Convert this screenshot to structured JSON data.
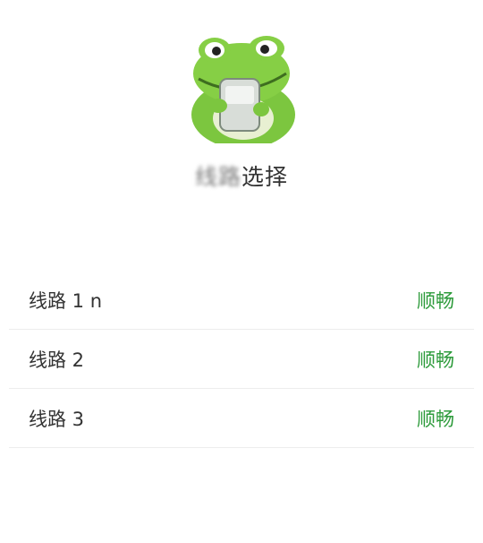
{
  "header": {
    "logo_icon": "frog-reading-phone-icon",
    "title_blurred": "线路",
    "title_visible": "选择"
  },
  "lines": [
    {
      "name": "线路 1 n",
      "status": "顺畅"
    },
    {
      "name": "线路 2",
      "status": "顺畅"
    },
    {
      "name": "线路 3",
      "status": "顺畅"
    }
  ],
  "colors": {
    "status_ok": "#2e9b3c",
    "text": "#333333",
    "divider": "#ededed",
    "background": "#ffffff"
  }
}
